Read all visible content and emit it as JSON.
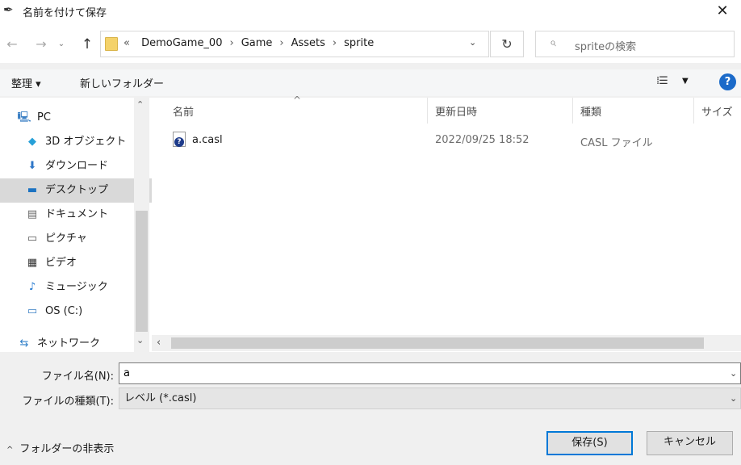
{
  "window": {
    "title": "名前を付けて保存",
    "app_icon": "feather-icon",
    "close_label": "✕"
  },
  "nav": {
    "back_label": "←",
    "forward_label": "→",
    "recent_label": "⌄",
    "up_label": "↑",
    "refresh_label": "↻"
  },
  "address": {
    "more": "«",
    "crumbs": [
      "DemoGame_00",
      "Game",
      "Assets",
      "sprite"
    ],
    "separator": "›",
    "dropdown": "⌄"
  },
  "search": {
    "placeholder": "spriteの検索",
    "icon": "⌕"
  },
  "toolbar": {
    "organize_label": "整理 ▾",
    "newfolder_label": "新しいフォルダー",
    "view_label": "⁞☰",
    "view_dropdown": "▼",
    "help_label": "?"
  },
  "sidebar": {
    "items": [
      {
        "label": "PC",
        "icon": "computer-icon",
        "glyph": "🖳",
        "indent": false,
        "selected": false
      },
      {
        "label": "3D オブジェクト",
        "icon": "3d-objects-icon",
        "glyph": "◆",
        "indent": true,
        "selected": false
      },
      {
        "label": "ダウンロード",
        "icon": "download-icon",
        "glyph": "⬇",
        "indent": true,
        "selected": false
      },
      {
        "label": "デスクトップ",
        "icon": "desktop-icon",
        "glyph": "▬",
        "indent": true,
        "selected": true
      },
      {
        "label": "ドキュメント",
        "icon": "document-icon",
        "glyph": "▤",
        "indent": true,
        "selected": false
      },
      {
        "label": "ピクチャ",
        "icon": "picture-icon",
        "glyph": "▭",
        "indent": true,
        "selected": false
      },
      {
        "label": "ビデオ",
        "icon": "video-icon",
        "glyph": "▦",
        "indent": true,
        "selected": false
      },
      {
        "label": "ミュージック",
        "icon": "music-icon",
        "glyph": "♪",
        "indent": true,
        "selected": false
      },
      {
        "label": "OS (C:)",
        "icon": "drive-icon",
        "glyph": "▭",
        "indent": true,
        "selected": false
      },
      {
        "label": "ネットワーク",
        "icon": "network-icon",
        "glyph": "⇆",
        "indent": false,
        "selected": false
      }
    ],
    "scroll_up": "⌃",
    "scroll_down": "⌄"
  },
  "filelist": {
    "columns": [
      "名前",
      "更新日時",
      "種類",
      "サイズ"
    ],
    "sort_indicator": "^",
    "rows": [
      {
        "name": "a.casl",
        "modified": "2022/09/25 18:52",
        "type": "CASL ファイル",
        "size": ""
      }
    ],
    "hscroll_left": "‹"
  },
  "form": {
    "filename_label": "ファイル名(N):",
    "filename_value": "a",
    "filetype_label": "ファイルの種類(T):",
    "filetype_value": "レベル (*.casl)",
    "dropdown": "⌄"
  },
  "footer": {
    "toggle_chevron": "^",
    "toggle_label": "フォルダーの非表示",
    "save_label": "保存(S)",
    "cancel_label": "キャンセル"
  },
  "colors": {
    "accent": "#0078d7",
    "help": "#1b6ac9",
    "selected_nav": "#d9d9d9"
  }
}
